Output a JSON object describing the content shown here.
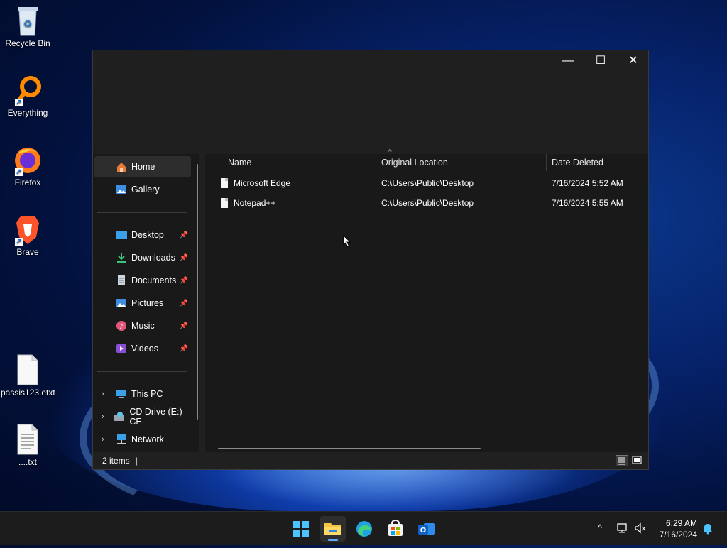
{
  "desktop": {
    "icons": [
      {
        "label": "Recycle Bin",
        "icon": "recycle-bin-icon"
      },
      {
        "label": "Everything",
        "icon": "everything-search-icon"
      },
      {
        "label": "Firefox",
        "icon": "firefox-icon"
      },
      {
        "label": "Brave",
        "icon": "brave-icon"
      },
      {
        "label": "passis123.etxt",
        "icon": "blank-file-icon"
      },
      {
        "label": "....txt",
        "icon": "text-file-icon"
      }
    ]
  },
  "window": {
    "controls": {
      "minimize": "—",
      "maximize": "☐",
      "close": "✕"
    },
    "sidebar": {
      "items": [
        {
          "label": "Home",
          "icon": "home-icon"
        },
        {
          "label": "Gallery",
          "icon": "gallery-icon"
        },
        {
          "label": "Desktop",
          "icon": "desktop-icon",
          "pin": "📌"
        },
        {
          "label": "Downloads",
          "icon": "downloads-icon",
          "pin": "📌"
        },
        {
          "label": "Documents",
          "icon": "documents-icon",
          "pin": "📌"
        },
        {
          "label": "Pictures",
          "icon": "pictures-icon",
          "pin": "📌"
        },
        {
          "label": "Music",
          "icon": "music-icon",
          "pin": "📌"
        },
        {
          "label": "Videos",
          "icon": "videos-icon",
          "pin": "📌"
        },
        {
          "label": "This PC",
          "icon": "this-pc-icon",
          "chevron": "›"
        },
        {
          "label": "CD Drive (E:) CE",
          "icon": "cd-drive-icon",
          "chevron": "›"
        },
        {
          "label": "Network",
          "icon": "network-icon",
          "chevron": "›"
        }
      ]
    },
    "columns": {
      "name": "Name",
      "original_location": "Original Location",
      "date_deleted": "Date Deleted",
      "sort_indicator": "^"
    },
    "rows": [
      {
        "name": "Microsoft Edge",
        "location": "C:\\Users\\Public\\Desktop",
        "date": "7/16/2024 5:52 AM"
      },
      {
        "name": "Notepad++",
        "location": "C:\\Users\\Public\\Desktop",
        "date": "7/16/2024 5:55 AM"
      }
    ],
    "status": {
      "count": "2 items",
      "separator": "|"
    }
  },
  "taskbar": {
    "apps": [
      "windows-start-icon",
      "file-explorer-icon",
      "edge-icon",
      "microsoft-store-icon",
      "outlook-icon"
    ],
    "tray_overflow": "^",
    "time": "6:29 AM",
    "date": "7/16/2024"
  },
  "colors": {
    "accent": "#60a9ff",
    "window_bg": "#202020",
    "pane_bg": "#191919"
  }
}
